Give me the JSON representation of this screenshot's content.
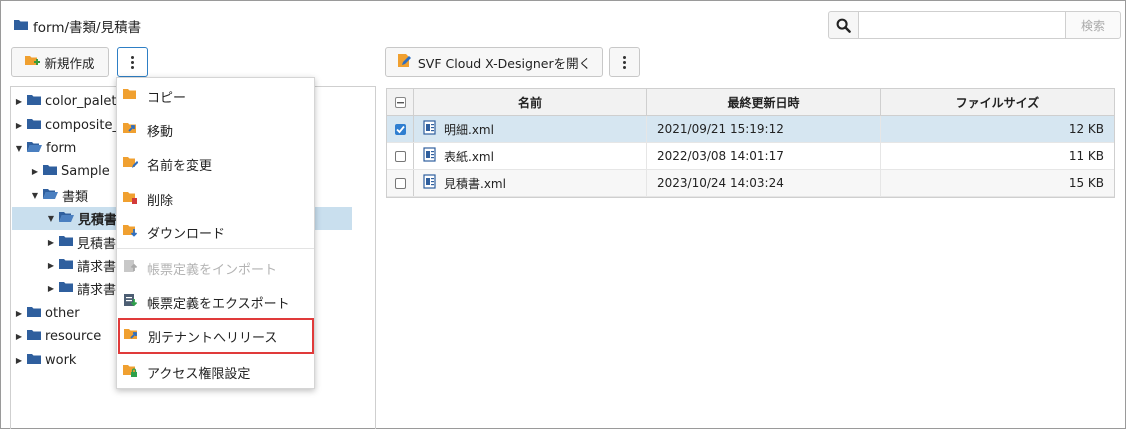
{
  "breadcrumb": {
    "path": "form/書類/見積書"
  },
  "search": {
    "value": "",
    "placeholder": "",
    "submit_label": "検索"
  },
  "toolbar": {
    "new_label": "新規作成",
    "svf_label": "SVF Cloud X-Designerを開く"
  },
  "tree": {
    "items": [
      {
        "label": "color_palett",
        "expanded": false
      },
      {
        "label": "composite_",
        "expanded": false
      },
      {
        "label": "form",
        "expanded": true
      },
      {
        "label": "Sample",
        "expanded": false
      },
      {
        "label": "書類",
        "expanded": true
      },
      {
        "label": "見積書",
        "expanded": true,
        "selected": true
      },
      {
        "label": "見積書",
        "expanded": false
      },
      {
        "label": "請求書",
        "expanded": false
      },
      {
        "label": "請求書",
        "expanded": false
      },
      {
        "label": "other",
        "expanded": false
      },
      {
        "label": "resource",
        "expanded": false
      },
      {
        "label": "work",
        "expanded": false
      }
    ]
  },
  "context_menu": {
    "items": [
      {
        "label": "コピー",
        "icon": "folder-copy-icon",
        "disabled": false
      },
      {
        "label": "移動",
        "icon": "folder-move-icon",
        "disabled": false
      },
      {
        "label": "名前を変更",
        "icon": "folder-rename-icon",
        "disabled": false
      },
      {
        "label": "削除",
        "icon": "folder-delete-icon",
        "disabled": false
      },
      {
        "label": "ダウンロード",
        "icon": "folder-download-icon",
        "disabled": false
      },
      {
        "label": "帳票定義をインポート",
        "icon": "import-icon",
        "disabled": true
      },
      {
        "label": "帳票定義をエクスポート",
        "icon": "export-icon",
        "disabled": false
      },
      {
        "label": "別テナントへリリース",
        "icon": "folder-release-icon",
        "disabled": false,
        "highlighted": true
      },
      {
        "label": "アクセス権限設定",
        "icon": "folder-lock-icon",
        "disabled": false
      }
    ]
  },
  "file_table": {
    "columns": [
      "名前",
      "最終更新日時",
      "ファイルサイズ"
    ],
    "rows": [
      {
        "name": "明細.xml",
        "modified": "2021/09/21 15:19:12",
        "size": "12 KB",
        "checked": true
      },
      {
        "name": "表紙.xml",
        "modified": "2022/03/08 14:01:17",
        "size": "11 KB",
        "checked": false
      },
      {
        "name": "見積書.xml",
        "modified": "2023/10/24 14:03:24",
        "size": "15 KB",
        "checked": false
      }
    ]
  },
  "colors": {
    "folder": "#2f5f9e",
    "menu_folder": "#f0a030",
    "selection": "#c9dfee",
    "highlight_border": "#e03a3a",
    "accent": "#2e7fc5"
  }
}
